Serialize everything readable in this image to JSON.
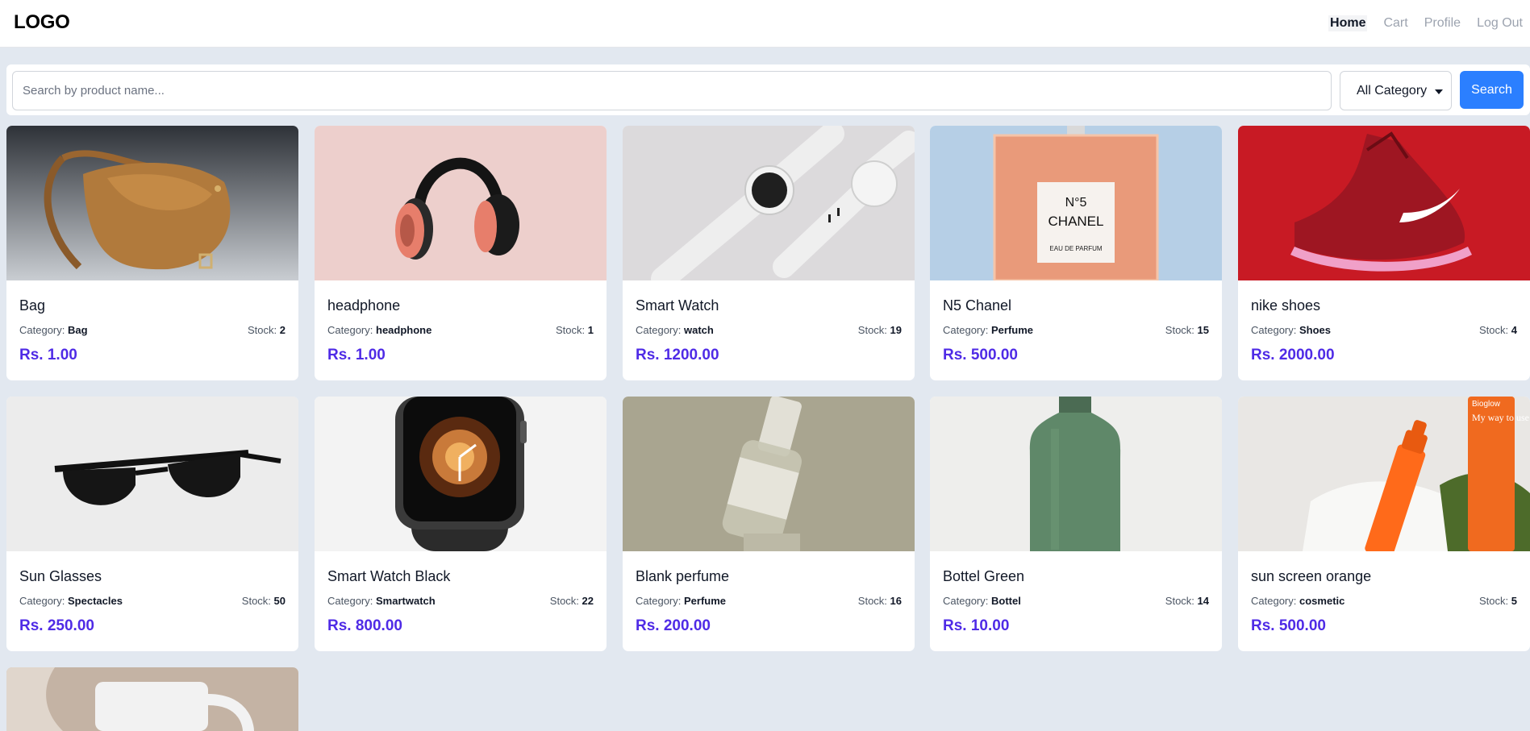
{
  "nav": {
    "logo": "LOGO",
    "links": [
      "Home",
      "Cart",
      "Profile",
      "Log Out"
    ]
  },
  "search": {
    "placeholder": "Search by product name...",
    "value": "",
    "category_selected": "All Category",
    "button_label": "Search"
  },
  "labels": {
    "category": "Category:",
    "stock": "Stock:"
  },
  "products": [
    {
      "name": "Bag",
      "category": "Bag",
      "stock": "2",
      "price": "Rs. 1.00",
      "image": "leather-bag"
    },
    {
      "name": "headphone",
      "category": "headphone",
      "stock": "1",
      "price": "Rs. 1.00",
      "image": "headphones"
    },
    {
      "name": "Smart Watch",
      "category": "watch",
      "stock": "19",
      "price": "Rs. 1200.00",
      "image": "white-smartwatches"
    },
    {
      "name": "N5 Chanel",
      "category": "Perfume",
      "stock": "15",
      "price": "Rs. 500.00",
      "image": "chanel-bottle"
    },
    {
      "name": "nike shoes",
      "category": "Shoes",
      "stock": "4",
      "price": "Rs. 2000.00",
      "image": "red-sneaker"
    },
    {
      "name": "Sun Glasses",
      "category": "Spectacles",
      "stock": "50",
      "price": "Rs. 250.00",
      "image": "sunglasses"
    },
    {
      "name": "Smart Watch Black",
      "category": "Smartwatch",
      "stock": "22",
      "price": "Rs. 800.00",
      "image": "black-smartwatch"
    },
    {
      "name": "Blank perfume",
      "category": "Perfume",
      "stock": "16",
      "price": "Rs. 200.00",
      "image": "blank-perfume"
    },
    {
      "name": "Bottel Green",
      "category": "Bottel",
      "stock": "14",
      "price": "Rs. 10.00",
      "image": "green-bottle"
    },
    {
      "name": "sun screen orange",
      "category": "cosmetic",
      "stock": "5",
      "price": "Rs. 500.00",
      "image": "orange-sunscreen"
    },
    {
      "name": "",
      "category": "",
      "stock": "",
      "price": "",
      "image": "white-mug"
    }
  ],
  "image_text": {
    "chanel_line1": "N°5",
    "chanel_line2": "CHANEL",
    "chanel_line3": "EAU DE PARFUM",
    "sunscreen_brand": "Bioglow",
    "sunscreen_tagline": "My way to use less makeup"
  },
  "colors": {
    "page_bg": "#e2e8f0",
    "accent_button": "#2b7fff",
    "price": "#4f2be6"
  }
}
